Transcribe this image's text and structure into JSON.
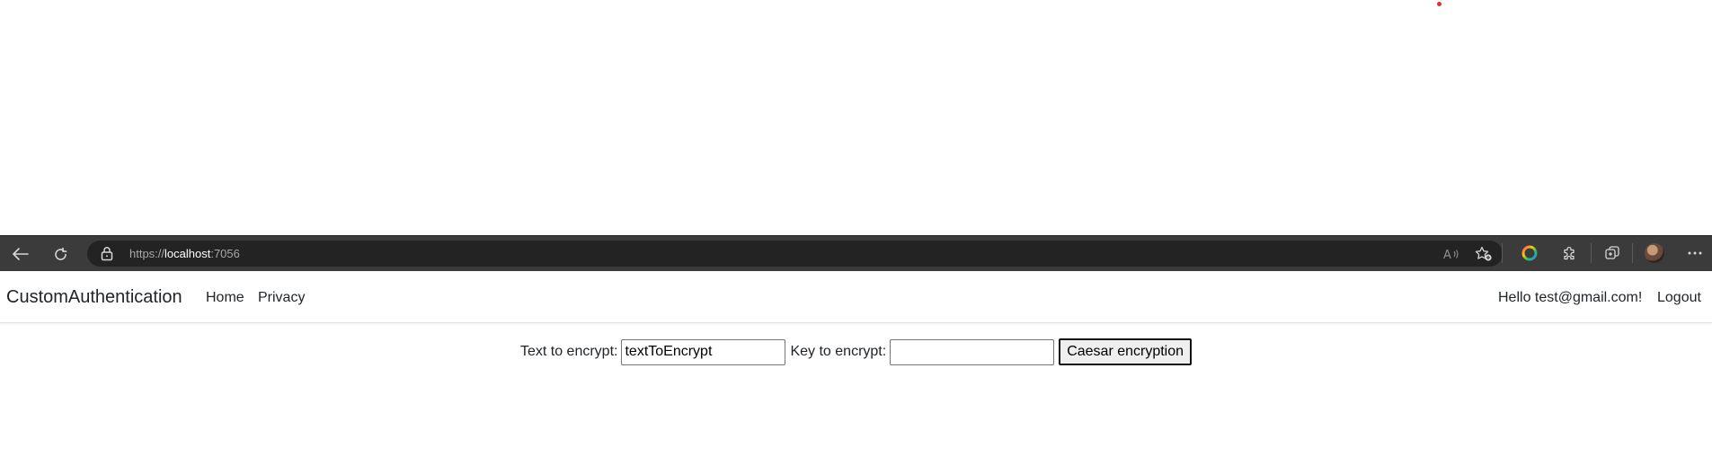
{
  "browser": {
    "url_scheme": "https://",
    "url_host": "localhost",
    "url_port": ":7056",
    "icons": [
      "back-arrow-icon",
      "refresh-icon",
      "lock-icon",
      "read-aloud-icon",
      "favorite-add-icon",
      "color-wheel-icon",
      "extensions-icon",
      "collections-icon",
      "profile-avatar",
      "more-icon"
    ]
  },
  "navbar": {
    "brand": "CustomAuthentication",
    "links": [
      {
        "label": "Home"
      },
      {
        "label": "Privacy"
      }
    ],
    "greeting": "Hello test@gmail.com!",
    "logout": "Logout"
  },
  "form": {
    "text_label": "Text to encrypt:",
    "text_value": "textToEncrypt",
    "key_label": "Key to encrypt:",
    "key_value": "",
    "submit_label": "Caesar encryption"
  },
  "colors": {
    "toolbar_bg": "#3b3b3b",
    "address_bg": "#232323",
    "cursor_dot": "#e0302a"
  }
}
